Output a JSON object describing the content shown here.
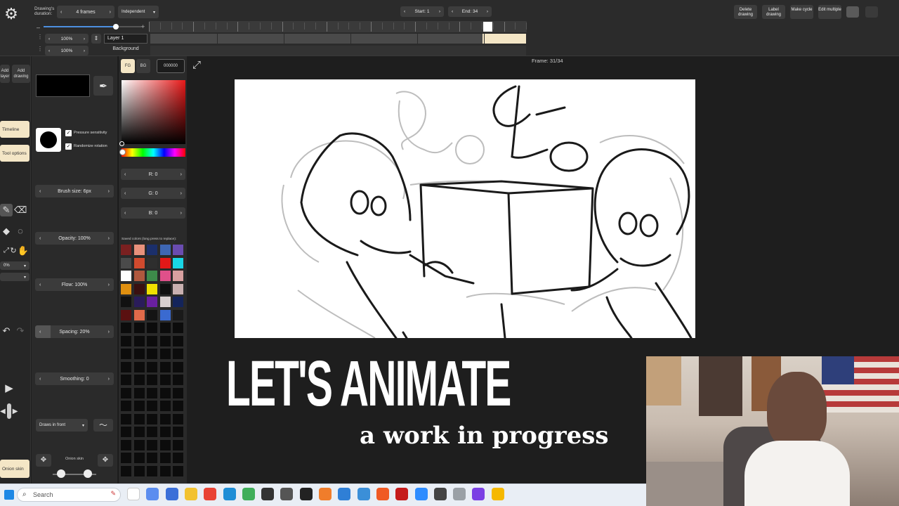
{
  "topbar": {
    "drawing_duration_label": "Drawing's duration:",
    "duration_value": "4 frames",
    "mode": "Independent",
    "start": "Start: 1",
    "end": "End: 34",
    "buttons": [
      "Delete drawing",
      "Label drawing",
      "Make cycle",
      "Edit multiple"
    ]
  },
  "layers": {
    "zoom1": "100%",
    "zoom2": "100%",
    "layer1": "Layer 1",
    "background": "Background"
  },
  "frame_info": "Frame: 31/34",
  "tools": {
    "add_layer": "Add layer",
    "add_drawing": "Add drawing",
    "timeline": "Timeline",
    "tool_options": "Tool options",
    "percent": "0%",
    "onion_skin": "Onion skin"
  },
  "brush": {
    "pressure": "Pressure sensitivity",
    "randomize": "Randomize rotation",
    "size": "Brush size: 6px",
    "opacity": "Opacity: 100%",
    "flow": "Flow: 100%",
    "spacing": "Spacing: 20%",
    "smoothing": "Smoothing: 0",
    "draws_in_front": "Draws in front",
    "onion_skin": "Onion skin"
  },
  "color": {
    "fg": "FG",
    "bg": "BG",
    "hex": "000000",
    "r": "R: 0",
    "g": "G: 0",
    "b": "B: 0",
    "saved_label": "Saved colors (long press to replace):",
    "swatches": [
      "#7a2020",
      "#e8917c",
      "#1b2f6b",
      "#3e67b5",
      "#6a4cb0",
      "#4a4a4a",
      "#d04a2e",
      "#2e2e2e",
      "#e21818",
      "#19d6e6",
      "#ffffff",
      "#b0583e",
      "#3d8a4a",
      "#e0508a",
      "#d8a0a0",
      "#e09010",
      "#3a1010",
      "#f0e000",
      "#101010",
      "#c8b0b0",
      "#111111",
      "#2a1c5a",
      "#6a20a0",
      "#d8d0d0",
      "#14245a",
      "#5a1010",
      "#e06a4a",
      "#141414",
      "#3a6ad0",
      "#1a1a1a"
    ]
  },
  "overlay": {
    "title": "LET'S ANIMATE",
    "subtitle": "a work in progress"
  },
  "taskbar": {
    "search_placeholder": "Search"
  }
}
